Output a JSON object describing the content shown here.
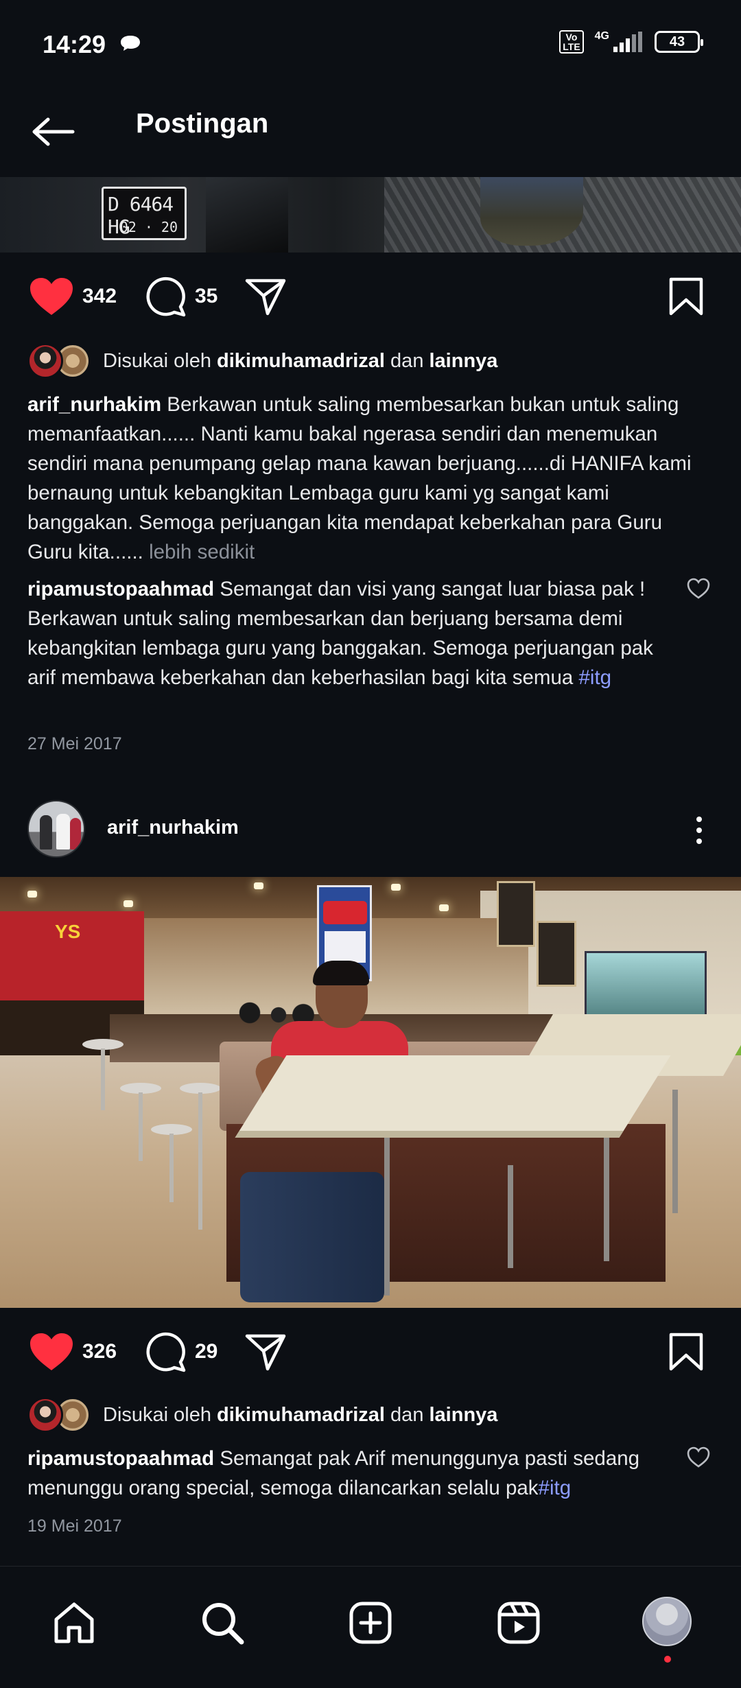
{
  "status_bar": {
    "time": "14:29",
    "volte": "Vo LTE",
    "network": "4G",
    "battery": "43"
  },
  "header": {
    "title": "Postingan"
  },
  "post1": {
    "plate_number": "D 6464 HG",
    "plate_expiry": "02 · 20",
    "likes": "342",
    "comments": "35",
    "liked_by_prefix": "Disukai oleh ",
    "liked_by_user": "dikimuhamadrizal",
    "liked_by_and": " dan ",
    "liked_by_others": "lainnya",
    "caption_user": "arif_nurhakim",
    "caption_text": " Berkawan untuk saling membesarkan bukan untuk saling memanfaatkan...... Nanti kamu bakal ngerasa sendiri dan menemukan sendiri mana penumpang gelap mana kawan berjuang......di HANIFA kami bernaung untuk kebangkitan Lembaga guru kami yg sangat kami banggakan. Semoga perjuangan kita mendapat keberkahan para Guru Guru kita...... ",
    "caption_more": "lebih sedikit",
    "comment_user": "ripamustopaahmad",
    "comment_text": " Semangat dan visi yang sangat luar biasa pak ! Berkawan untuk saling membesarkan dan berjuang bersama demi kebangkitan lembaga guru yang banggakan. Semoga perjuangan pak arif membawa keberkahan dan keberhasilan bagi kita semua ",
    "comment_tag": "#itg",
    "date": "27 Mei 2017"
  },
  "post2": {
    "username": "arif_nurhakim",
    "photo_sign": "YS",
    "likes": "326",
    "comments": "29",
    "liked_by_prefix": "Disukai oleh ",
    "liked_by_user": "dikimuhamadrizal",
    "liked_by_and": " dan ",
    "liked_by_others": "lainnya",
    "comment_user": "ripamustopaahmad",
    "comment_text": " Semangat pak Arif menunggunya pasti sedang menunggu orang special, semoga dilancarkan selalu pak",
    "comment_tag": "#itg",
    "date": "19 Mei 2017"
  },
  "bottom_nav": {
    "items": [
      "home-icon",
      "search-icon",
      "create-icon",
      "reels-icon",
      "profile-avatar"
    ]
  },
  "colors": {
    "background": "#0c0f14",
    "like_red": "#ff3040",
    "hashtag": "#8d9dff",
    "muted": "#8b9099"
  }
}
